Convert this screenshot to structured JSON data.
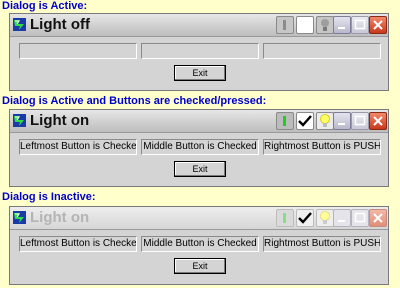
{
  "colors": {
    "caption": "#0000cc",
    "background": "#ffffcc",
    "toggle_green": "#22cc22",
    "bulb_yellow": "#ffff66",
    "close_red": "#cc3a1e"
  },
  "panels": [
    {
      "caption": "Dialog is Active:",
      "title": "Light off",
      "state": "active",
      "fields": [
        "",
        "",
        ""
      ],
      "exit_label": "Exit",
      "icons": [
        "app-icon",
        "toggle-icon",
        "check-icon",
        "bulb-icon",
        "minimize-icon",
        "maximize-icon",
        "close-icon"
      ]
    },
    {
      "caption": "Dialog is Active and Buttons are checked/pressed:",
      "title": "Light on",
      "state": "active-checked",
      "fields": [
        "Leftmost Button is Checked",
        "Middle Button is Checked",
        "Rightmost Button is PUSHED"
      ],
      "exit_label": "Exit",
      "icons": [
        "app-icon",
        "toggle-icon",
        "check-icon",
        "bulb-icon",
        "minimize-icon",
        "maximize-icon",
        "close-icon"
      ]
    },
    {
      "caption": "Dialog is Inactive:",
      "title": "Light on",
      "state": "inactive",
      "fields": [
        "Leftmost Button is Checked",
        "Middle Button is Checked",
        "Rightmost Button is PUSHED"
      ],
      "exit_label": "Exit",
      "icons": [
        "app-icon",
        "toggle-icon",
        "check-icon",
        "bulb-icon",
        "minimize-icon",
        "maximize-icon",
        "close-icon"
      ]
    }
  ]
}
